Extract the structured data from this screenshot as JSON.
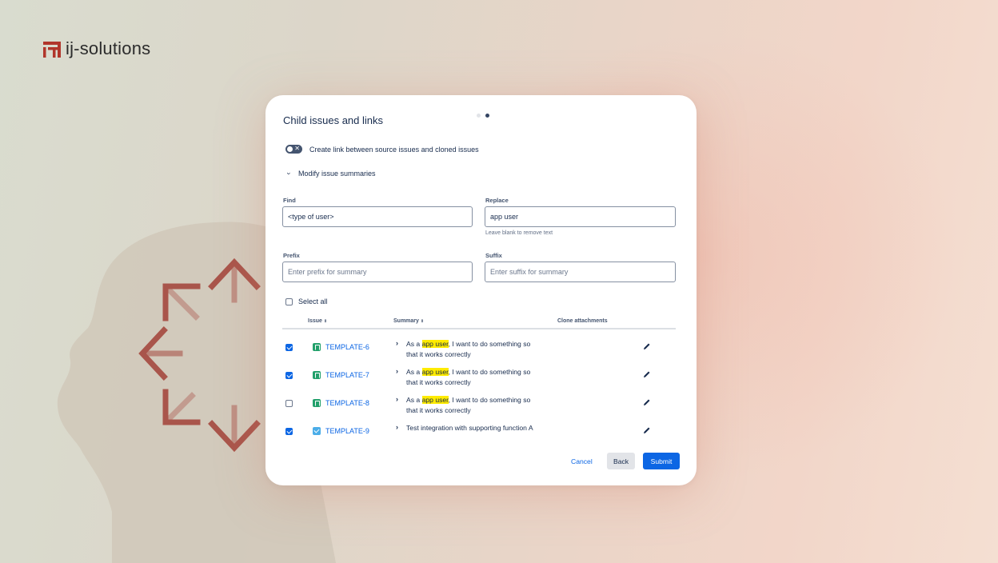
{
  "brand": {
    "name": "ij-solutions",
    "logo_color": "#b1362b"
  },
  "background": {
    "arrow_color": "#a9554b",
    "head_color": "#cfc5b7"
  },
  "modal": {
    "title": "Child issues and links",
    "steps": {
      "current": 2,
      "total": 2
    },
    "toggle": {
      "label": "Create link between source issues and cloned issues",
      "checked": false
    },
    "modify_label": "Modify issue summaries",
    "find": {
      "label": "Find",
      "value": "<type of user>"
    },
    "replace": {
      "label": "Replace",
      "value": "app user",
      "hint": "Leave blank to remove text"
    },
    "prefix": {
      "label": "Prefix",
      "placeholder": "Enter prefix for summary"
    },
    "suffix": {
      "label": "Suffix",
      "placeholder": "Enter suffix for summary"
    },
    "select_all": "Select all",
    "columns": {
      "issue": "Issue",
      "summary": "Summary",
      "clone": "Clone attachments"
    },
    "rows": [
      {
        "checked": true,
        "key": "TEMPLATE-6",
        "type": "story",
        "pre": "As a ",
        "highlight": "app user",
        "post": ", I want to do something so that it works correctly"
      },
      {
        "checked": true,
        "key": "TEMPLATE-7",
        "type": "story",
        "pre": "As a ",
        "highlight": "app user",
        "post": ", I want to do something so that it works correctly"
      },
      {
        "checked": false,
        "key": "TEMPLATE-8",
        "type": "story",
        "pre": "As a ",
        "highlight": "app user",
        "post": ", I want to do something so that it works correctly"
      },
      {
        "checked": true,
        "key": "TEMPLATE-9",
        "type": "task",
        "pre": "Test integration with supporting function A",
        "highlight": "",
        "post": ""
      }
    ],
    "buttons": {
      "cancel": "Cancel",
      "back": "Back",
      "submit": "Submit"
    },
    "accent": "#0c66e4"
  }
}
